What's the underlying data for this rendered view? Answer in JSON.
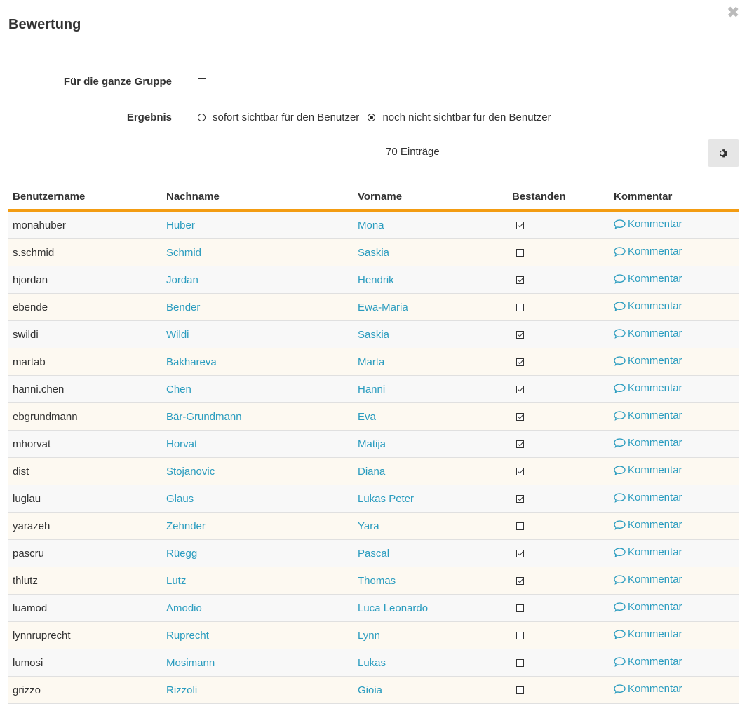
{
  "dialog": {
    "title": "Bewertung"
  },
  "form": {
    "group_label": "Für die ganze Gruppe",
    "result_label": "Ergebnis",
    "result_options": [
      {
        "label": "sofort sichtbar für den Benutzer",
        "selected": false
      },
      {
        "label": "noch nicht sichtbar für den Benutzer",
        "selected": true
      }
    ],
    "group_checked": false
  },
  "table": {
    "entries_text": "70 Einträge",
    "columns": [
      "Benutzername",
      "Nachname",
      "Vorname",
      "Bestanden",
      "Kommentar"
    ],
    "comment_label": "Kommentar",
    "rows": [
      {
        "username": "monahuber",
        "lastname": "Huber",
        "firstname": "Mona",
        "passed": true
      },
      {
        "username": "s.schmid",
        "lastname": "Schmid",
        "firstname": "Saskia",
        "passed": false
      },
      {
        "username": "hjordan",
        "lastname": "Jordan",
        "firstname": "Hendrik",
        "passed": true
      },
      {
        "username": "ebende",
        "lastname": "Bender",
        "firstname": "Ewa-Maria",
        "passed": false
      },
      {
        "username": "swildi",
        "lastname": "Wildi",
        "firstname": "Saskia",
        "passed": true
      },
      {
        "username": "martab",
        "lastname": "Bakhareva",
        "firstname": "Marta",
        "passed": true
      },
      {
        "username": "hanni.chen",
        "lastname": "Chen",
        "firstname": "Hanni",
        "passed": true
      },
      {
        "username": "ebgrundmann",
        "lastname": "Bär-Grundmann",
        "firstname": "Eva",
        "passed": true
      },
      {
        "username": "mhorvat",
        "lastname": "Horvat",
        "firstname": "Matija",
        "passed": true
      },
      {
        "username": "dist",
        "lastname": "Stojanovic",
        "firstname": "Diana",
        "passed": true
      },
      {
        "username": "luglau",
        "lastname": "Glaus",
        "firstname": "Lukas Peter",
        "passed": true
      },
      {
        "username": "yarazeh",
        "lastname": "Zehnder",
        "firstname": "Yara",
        "passed": false
      },
      {
        "username": "pascru",
        "lastname": "Rüegg",
        "firstname": "Pascal",
        "passed": true
      },
      {
        "username": "thlutz",
        "lastname": "Lutz",
        "firstname": "Thomas",
        "passed": true
      },
      {
        "username": "luamod",
        "lastname": "Amodio",
        "firstname": "Luca Leonardo",
        "passed": false
      },
      {
        "username": "lynnruprecht",
        "lastname": "Ruprecht",
        "firstname": "Lynn",
        "passed": false
      },
      {
        "username": "lumosi",
        "lastname": "Mosimann",
        "firstname": "Lukas",
        "passed": false
      },
      {
        "username": "grizzo",
        "lastname": "Rizzoli",
        "firstname": "Gioia",
        "passed": false
      }
    ]
  },
  "colors": {
    "accent": "#f39c12",
    "link": "#2a9cbf"
  },
  "icons": {
    "close": "close-icon",
    "settings": "gear-icon",
    "comment": "comment-bubble-icon"
  }
}
